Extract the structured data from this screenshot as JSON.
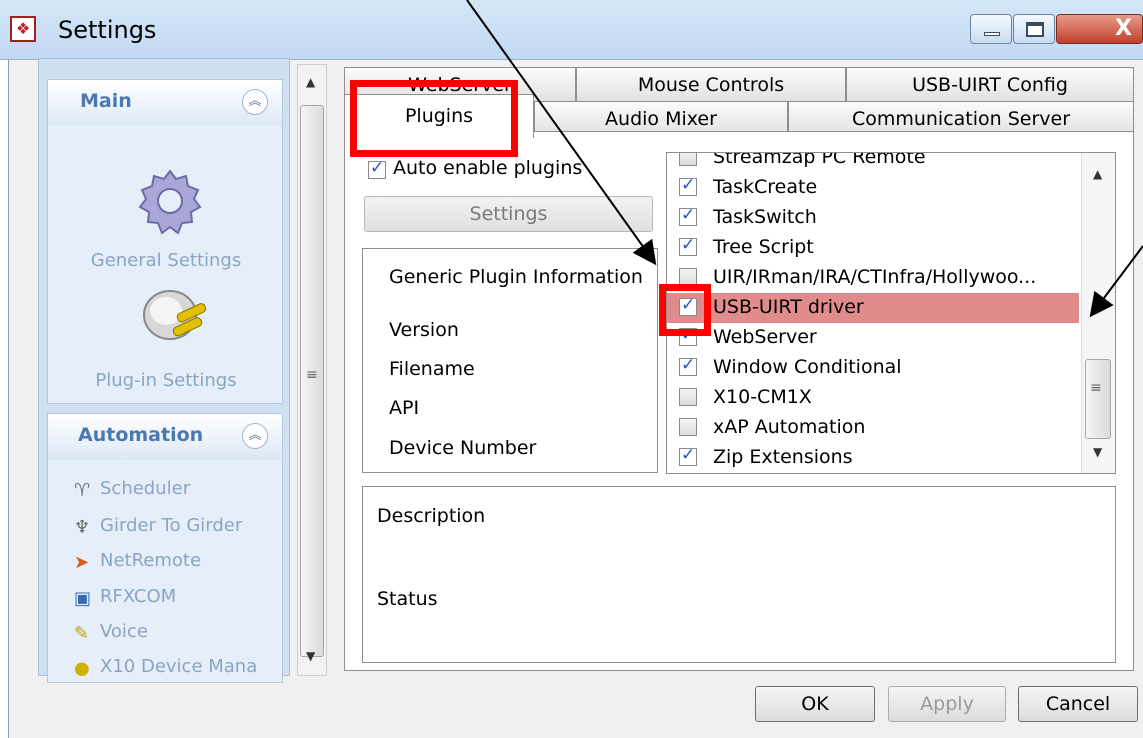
{
  "window": {
    "title": "Settings",
    "close_glyph": "X"
  },
  "left_pane": {
    "main_group": {
      "title": "Main",
      "items": [
        {
          "label": "General Settings",
          "icon": "gear-icon"
        },
        {
          "label": "Plug-in Settings",
          "icon": "plug-icon"
        }
      ]
    },
    "automation_group": {
      "title": "Automation",
      "items": [
        {
          "label": "Scheduler",
          "icon": "scheduler-icon"
        },
        {
          "label": "Girder To Girder",
          "icon": "girder-icon"
        },
        {
          "label": "NetRemote",
          "icon": "netremote-icon"
        },
        {
          "label": "RFXCOM",
          "icon": "rfxcom-icon"
        },
        {
          "label": "Voice",
          "icon": "voice-icon"
        },
        {
          "label": "X10 Device Mana",
          "icon": "x10-icon"
        }
      ]
    }
  },
  "tabs": {
    "back_row": [
      "WebServer",
      "Mouse Controls",
      "USB-UIRT Config"
    ],
    "front_row": [
      "Plugins",
      "Audio Mixer",
      "Communication Server"
    ],
    "active": "Plugins"
  },
  "plugins_tab": {
    "auto_enable_label": "Auto enable plugins",
    "auto_enable_checked": true,
    "settings_button": "Settings",
    "info": {
      "header": "Generic Plugin Information",
      "rows": [
        "Version",
        "Filename",
        "API",
        "Device Number"
      ]
    },
    "plugin_list": [
      {
        "label": "Streamzap PC Remote",
        "checked": false
      },
      {
        "label": "TaskCreate",
        "checked": true
      },
      {
        "label": "TaskSwitch",
        "checked": true
      },
      {
        "label": "Tree Script",
        "checked": true
      },
      {
        "label": "UIR/IRman/IRA/CTInfra/Hollywoo...",
        "checked": false
      },
      {
        "label": "USB-UIRT driver",
        "checked": true,
        "selected": true
      },
      {
        "label": "WebServer",
        "checked": true
      },
      {
        "label": "Window Conditional",
        "checked": true
      },
      {
        "label": "X10-CM1X",
        "checked": false
      },
      {
        "label": "xAP Automation",
        "checked": false
      },
      {
        "label": "Zip Extensions",
        "checked": true
      }
    ],
    "description_label": "Description",
    "status_label": "Status"
  },
  "buttons": {
    "ok": "OK",
    "apply": "Apply",
    "cancel": "Cancel"
  },
  "colors": {
    "selection": "#e08c8c",
    "annotation": "#ff0000",
    "group_title": "#4a78b0"
  }
}
